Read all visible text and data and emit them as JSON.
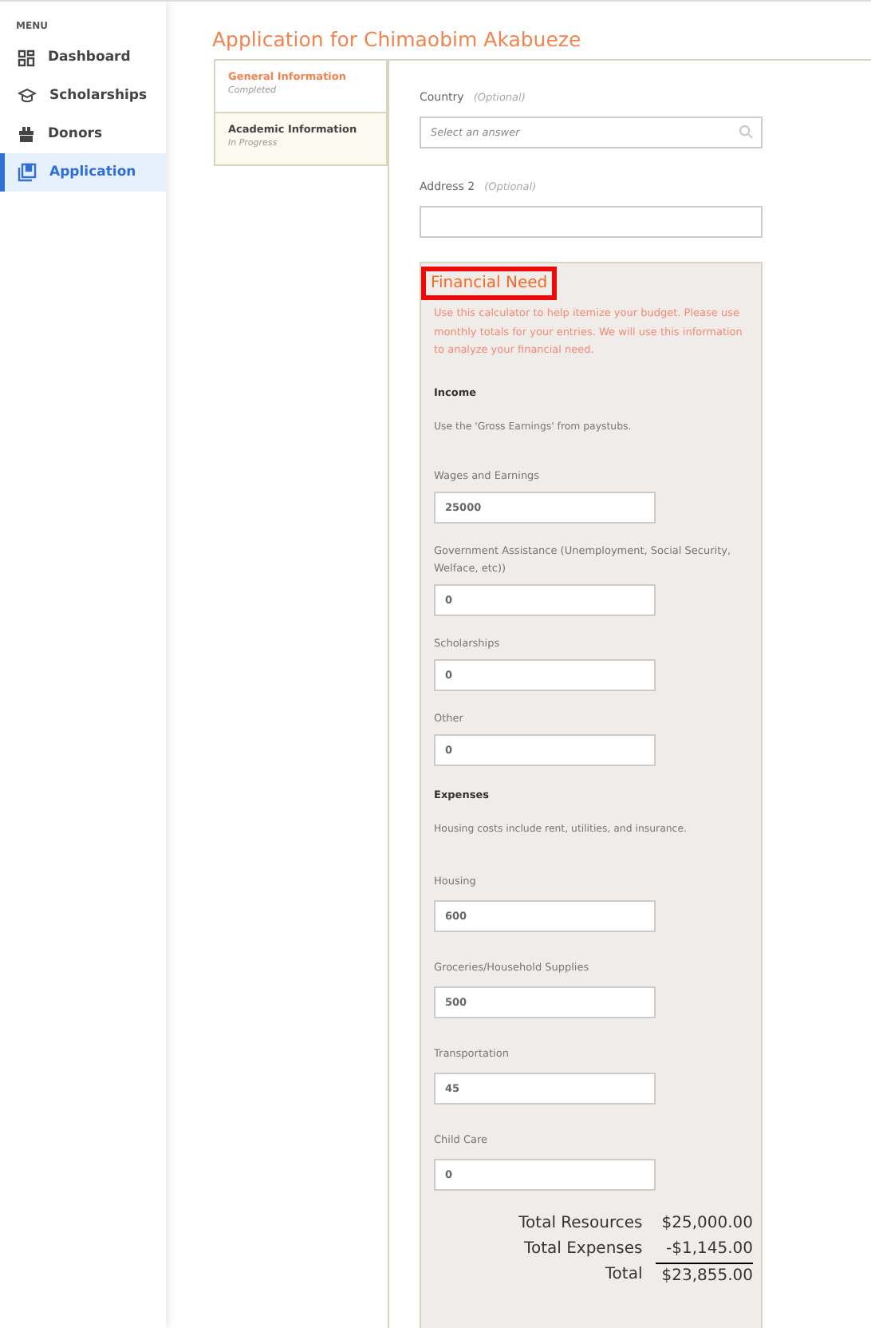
{
  "sidebar": {
    "heading": "MENU",
    "items": [
      {
        "label": "Dashboard",
        "kind": "dashboard",
        "selected": false
      },
      {
        "label": "Scholarships",
        "kind": "scholarships",
        "selected": false
      },
      {
        "label": "Donors",
        "kind": "donors",
        "selected": false
      },
      {
        "label": "Application",
        "kind": "application",
        "selected": true
      }
    ]
  },
  "page_title": "Application for Chimaobim Akabueze",
  "steps": [
    {
      "title": "General Information",
      "status": "Completed",
      "selected": true
    },
    {
      "title": "Academic Information",
      "status": "In Progress",
      "selected": false
    }
  ],
  "fields": [
    {
      "label": "Country",
      "optional": "(Optional)",
      "kind": "select",
      "placeholder": "Select an answer"
    },
    {
      "label": "Address 2",
      "optional": "(Optional)",
      "kind": "text"
    }
  ],
  "financial": {
    "title": "Financial Need",
    "highlighted": true,
    "intro": "Use this calculator to help itemize your budget. Please use monthly totals for your entries. We will use this information to analyze your financial need.",
    "groups": [
      {
        "heading": "Income",
        "note": "Use the 'Gross Earnings' from paystubs.",
        "fields": [
          {
            "label": "Wages and Earnings",
            "value": "25000"
          },
          {
            "label": "Government Assistance (Unemployment, Social Security, Welface, etc))",
            "value": "0"
          },
          {
            "label": "Scholarships",
            "value": "0"
          },
          {
            "label": "Other",
            "value": "0"
          }
        ]
      },
      {
        "heading": "Expenses",
        "note": "Housing costs include rent, utilities, and insurance.",
        "fields": [
          {
            "label": "Housing",
            "value": "600"
          },
          {
            "label": "Groceries/Household Supplies",
            "value": "500"
          },
          {
            "label": "Transportation",
            "value": "45"
          },
          {
            "label": "Child Care",
            "value": "0"
          }
        ]
      }
    ],
    "totals": [
      {
        "label": "Total Resources",
        "value": "$25,000.00"
      },
      {
        "label": "Total Expenses",
        "value": "-$1,145.00"
      },
      {
        "label": "Total",
        "value": "$23,855.00",
        "kind": "grand"
      }
    ]
  }
}
